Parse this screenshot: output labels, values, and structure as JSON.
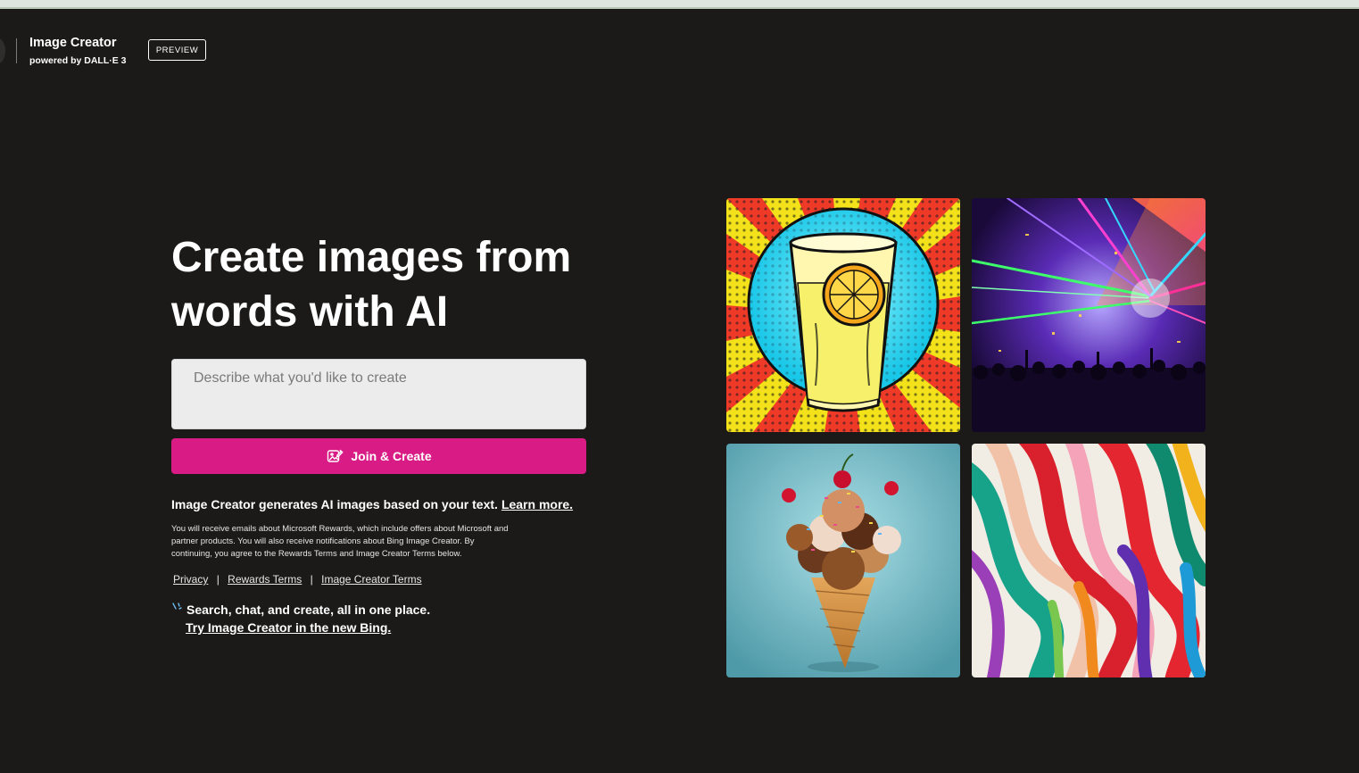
{
  "header": {
    "title": "Image Creator",
    "subtitle": "powered by DALL·E 3",
    "badge": "PREVIEW"
  },
  "hero": {
    "title": "Create images from words with AI"
  },
  "prompt": {
    "placeholder": "Describe what you'd like to create",
    "value": ""
  },
  "join_button": {
    "label": "Join & Create",
    "icon": "image-create-icon"
  },
  "description": {
    "text": "Image Creator generates AI images based on your text.",
    "link": "Learn more."
  },
  "fineprint": "You will receive emails about Microsoft Rewards, which include offers about Microsoft and partner products. You will also receive notifications about Bing Image Creator. By continuing, you agree to the Rewards Terms and Image Creator Terms below.",
  "legal_links": [
    {
      "label": "Privacy"
    },
    {
      "label": "Rewards Terms"
    },
    {
      "label": "Image Creator Terms"
    }
  ],
  "legal_separator": "|",
  "new_bing": {
    "icon": "sparkle-icon",
    "text": "Search, chat, and create, all in one place.",
    "link": "Try Image Creator in the new Bing."
  },
  "gallery": [
    {
      "name": "lemonade-pop-art-image"
    },
    {
      "name": "concert-lasers-image"
    },
    {
      "name": "ice-cream-cone-image"
    },
    {
      "name": "colorful-ribbons-image"
    }
  ],
  "colors": {
    "background": "#1b1a19",
    "accent": "#d91b86",
    "text": "#ffffff"
  }
}
